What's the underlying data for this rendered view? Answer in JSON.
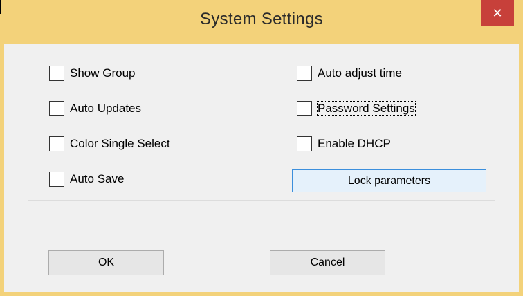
{
  "window": {
    "title": "System Settings",
    "close_glyph": "✕"
  },
  "settings": {
    "left": [
      {
        "label": "Show Group",
        "checked": false
      },
      {
        "label": "Auto Updates",
        "checked": false
      },
      {
        "label": "Color Single Select",
        "checked": false
      },
      {
        "label": "Auto Save",
        "checked": false
      }
    ],
    "right": [
      {
        "label": "Auto adjust time",
        "checked": false
      },
      {
        "label": "Password Settings",
        "checked": false
      },
      {
        "label": "Enable DHCP",
        "checked": false
      }
    ],
    "lock_button_label": "Lock parameters"
  },
  "footer": {
    "ok_label": "OK",
    "cancel_label": "Cancel"
  },
  "colors": {
    "title_bar": "#f3d27a",
    "close_button": "#c7403a",
    "dialog_background": "#f0f0f0",
    "primary_button_border": "#3c8fdc"
  }
}
